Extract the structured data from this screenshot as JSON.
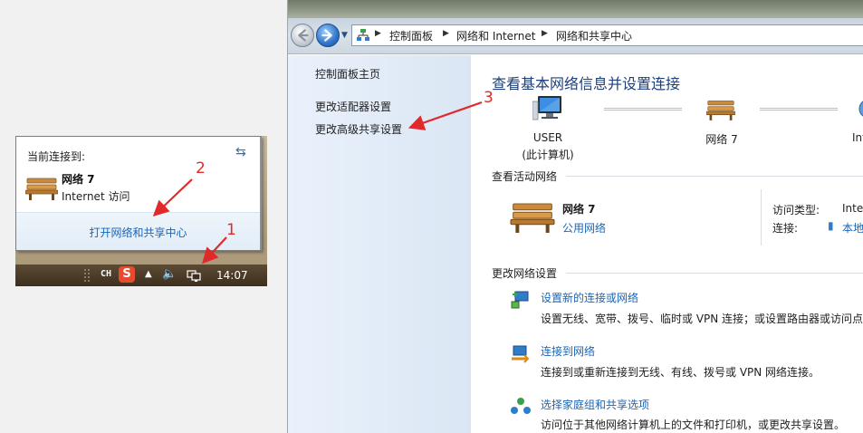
{
  "taskbar_popup": {
    "title": "当前连接到:",
    "network_name": "网络  7",
    "network_access": "Internet 访问",
    "open_center_link": "打开网络和共享中心",
    "lang_indicator": "CH",
    "ime_label": "S",
    "clock": "14:07"
  },
  "window": {
    "breadcrumb": [
      "控制面板",
      "网络和 Internet",
      "网络和共享中心"
    ],
    "sidebar": {
      "items": [
        {
          "label": "控制面板主页"
        },
        {
          "label": "更改适配器设置"
        },
        {
          "label": "更改高级共享设置"
        }
      ]
    },
    "main": {
      "title": "查看基本网络信息并设置连接",
      "map": {
        "computer": "USER",
        "computer_sub": "(此计算机)",
        "network": "网络  7",
        "internet": "Internet"
      },
      "active_section": "查看活动网络",
      "active_network": {
        "name": "网络  7",
        "type": "公用网络",
        "access_type_label": "访问类型:",
        "access_type_value": "Internet",
        "connection_label": "连接:",
        "connection_value": "本地连接"
      },
      "change_section": "更改网络设置",
      "tasks": [
        {
          "title": "设置新的连接或网络",
          "desc": "设置无线、宽带、拨号、临时或 VPN 连接；或设置路由器或访问点。"
        },
        {
          "title": "连接到网络",
          "desc": "连接到或重新连接到无线、有线、拨号或 VPN 网络连接。"
        },
        {
          "title": "选择家庭组和共享选项",
          "desc": "访问位于其他网络计算机上的文件和打印机，或更改共享设置。"
        }
      ]
    }
  },
  "annotations": [
    "1",
    "2",
    "3"
  ],
  "colors": {
    "link": "#1a65b8",
    "heading": "#1e3f7a",
    "annotation": "#e02a2a",
    "sidebar": "#dbe6f4"
  }
}
